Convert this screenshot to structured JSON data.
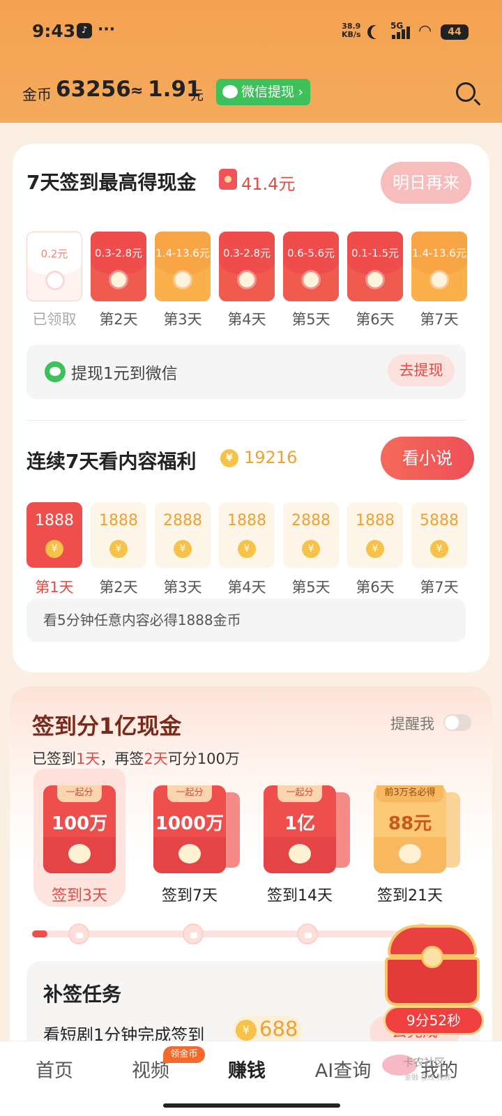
{
  "status": {
    "time": "9:43",
    "speed": "38.9",
    "speed_unit": "KB/s",
    "network": "5G",
    "battery": "44"
  },
  "header": {
    "coin_label": "金币",
    "coins": "63256",
    "approx": "≈",
    "cash": "1.91",
    "cash_unit": "元",
    "wechat_withdraw": "微信提现",
    "arrow": "›"
  },
  "checkin": {
    "title": "7天签到最高得现金",
    "max_amount": "41.4元",
    "button": "明日再来",
    "days": [
      {
        "amount": "0.2元",
        "label": "已领取",
        "state": "claimed"
      },
      {
        "amount": "0.3-2.8元",
        "label": "第2天",
        "state": "red"
      },
      {
        "amount": "1.4-13.6元",
        "label": "第3天",
        "state": "orange"
      },
      {
        "amount": "0.3-2.8元",
        "label": "第4天",
        "state": "red"
      },
      {
        "amount": "0.6-5.6元",
        "label": "第5天",
        "state": "red"
      },
      {
        "amount": "0.1-1.5元",
        "label": "第6天",
        "state": "red"
      },
      {
        "amount": "1.4-13.6元",
        "label": "第7天",
        "state": "orange"
      }
    ],
    "withdraw_text": "提现1元到微信",
    "withdraw_button": "去提现"
  },
  "watch": {
    "title": "连续7天看内容福利",
    "total": "19216",
    "button": "看小说",
    "coin_symbol": "¥",
    "days": [
      {
        "value": "1888",
        "label": "第1天"
      },
      {
        "value": "1888",
        "label": "第2天"
      },
      {
        "value": "2888",
        "label": "第3天"
      },
      {
        "value": "1888",
        "label": "第4天"
      },
      {
        "value": "2888",
        "label": "第5天"
      },
      {
        "value": "1888",
        "label": "第6天"
      },
      {
        "value": "5888",
        "label": "第7天"
      }
    ],
    "hint": "看5分钟任意内容必得1888金币"
  },
  "bigcheck": {
    "title": "签到分1亿现金",
    "remind": "提醒我",
    "sub_a": "已签到",
    "sub_days": "1天",
    "sub_b": "，再签",
    "sub_more": "2天",
    "sub_c": "可分100万",
    "prizes": [
      {
        "tag": "一起分",
        "amount": "100万",
        "label": "签到3天"
      },
      {
        "tag": "一起分",
        "amount": "1000万",
        "label": "签到7天"
      },
      {
        "tag": "一起分",
        "amount": "1亿",
        "label": "签到14天"
      },
      {
        "tag": "前3万名必得",
        "amount": "88元",
        "label": "签到21天"
      }
    ]
  },
  "makeup": {
    "title": "补签任务",
    "task": "看短剧1分钟完成签到",
    "coins": "688",
    "button": "去完成"
  },
  "chest": {
    "timer": "9分52秒"
  },
  "nav": {
    "items": [
      "首页",
      "视频",
      "赚钱",
      "AI查询",
      "我的"
    ],
    "badge": "领金币"
  },
  "watermark": {
    "text": "卡农社区",
    "sub": "金融 在线 视频"
  },
  "colors": {
    "accent": "#ef4f4c",
    "header": "#f3a250",
    "gold": "#f0a030",
    "wechat": "#3ec05a"
  }
}
